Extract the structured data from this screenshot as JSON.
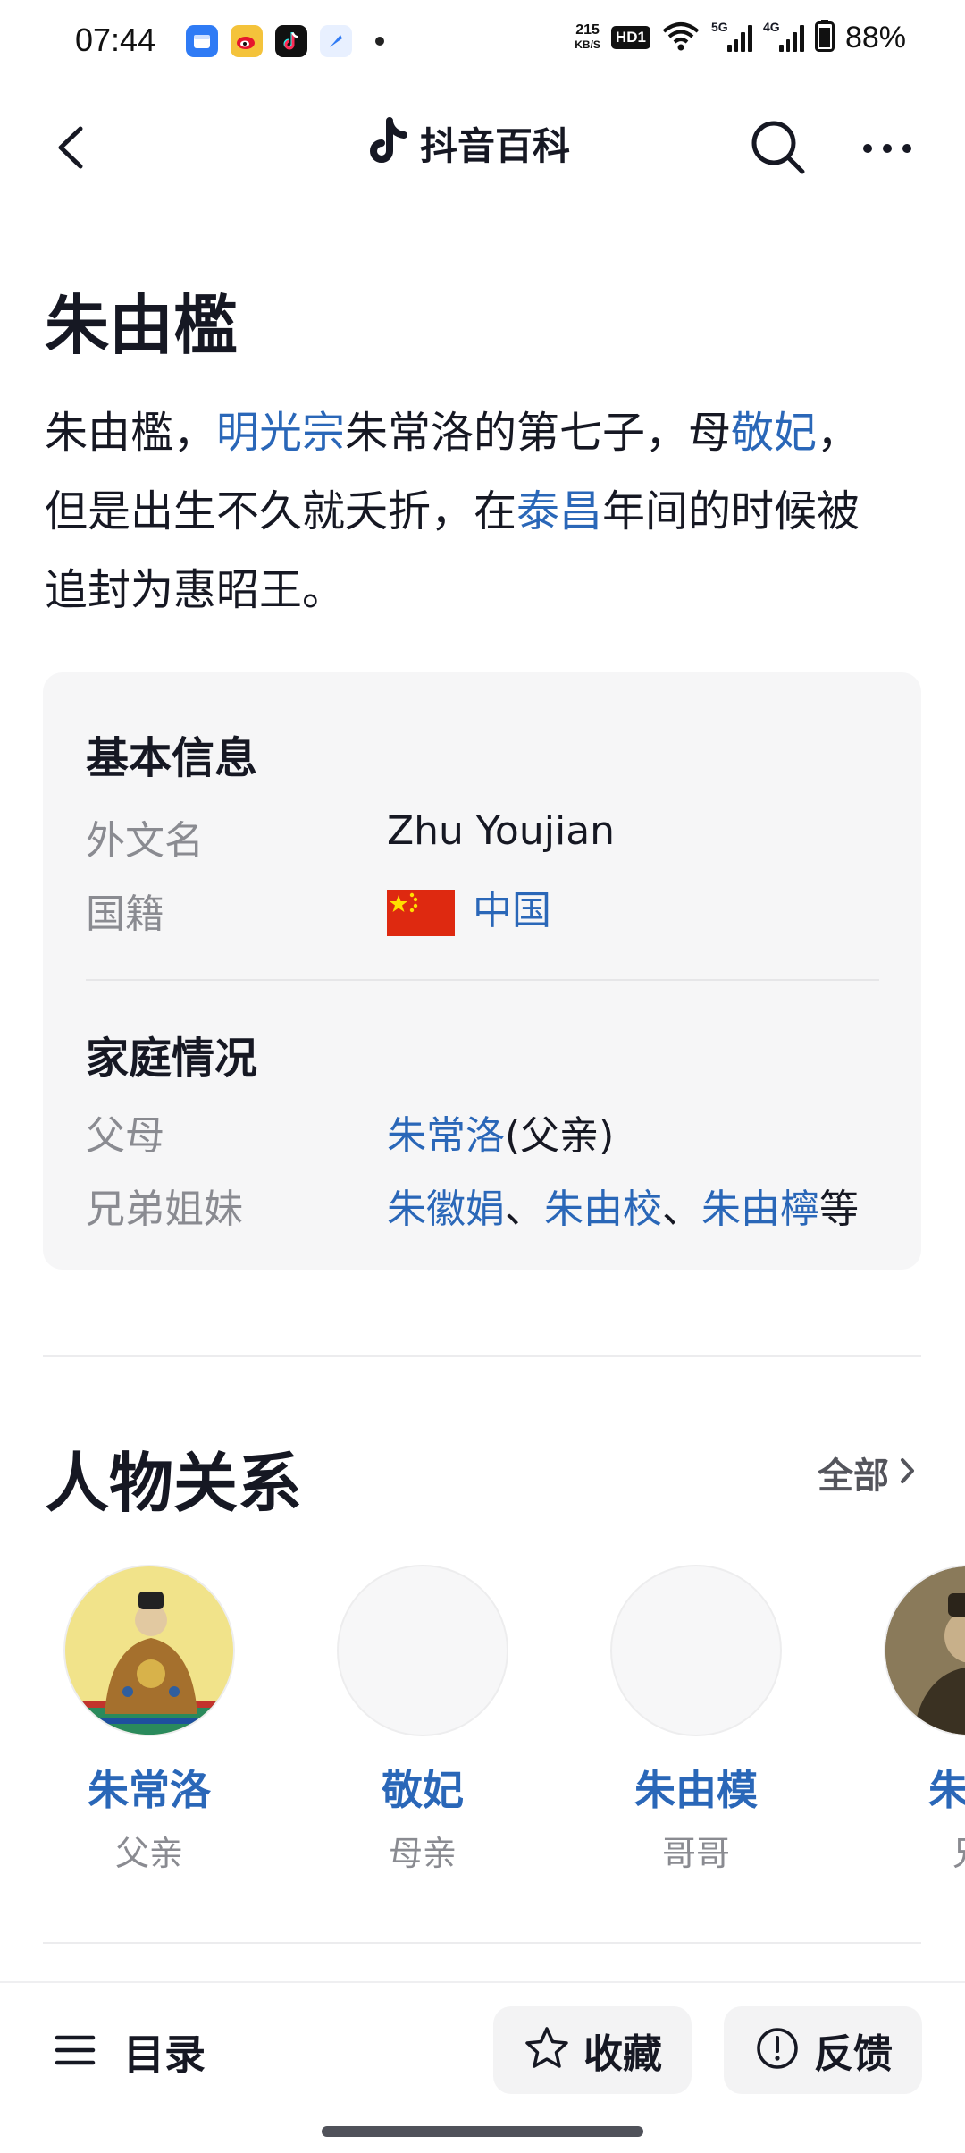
{
  "status": {
    "time": "07:44",
    "net_speed_value": "215",
    "net_speed_unit": "KB/S",
    "hd": "HD1",
    "sig1_tag": "5G",
    "sig2_tag": "4G",
    "battery": "88%"
  },
  "nav": {
    "brand": "抖音百科"
  },
  "article": {
    "title": "朱由檻",
    "summary": {
      "t1": "朱由檻，",
      "l1": "明光宗",
      "t2": "朱常洛的第七子，母",
      "l2": "敬妃",
      "t3": "，但是出生不久就夭折，在",
      "l3": "泰昌",
      "t4": "年间的时候被追封为惠昭王。"
    }
  },
  "infobox": {
    "basic_heading": "基本信息",
    "foreign_name_label": "外文名",
    "foreign_name_value": "Zhu Youjian",
    "nationality_label": "国籍",
    "nationality_value": "中国",
    "family_heading": "家庭情况",
    "parents_label": "父母",
    "parents_link": "朱常洛",
    "parents_note": "(父亲)",
    "siblings_label": "兄弟姐妹",
    "siblings": [
      "朱徽娟",
      "朱由校",
      "朱由檸"
    ],
    "sibling_sep": "、",
    "siblings_suffix": "等"
  },
  "relations": {
    "title": "人物关系",
    "more": "全部",
    "items": [
      {
        "name": "朱常洛",
        "role": "父亲"
      },
      {
        "name": "敬妃",
        "role": "母亲"
      },
      {
        "name": "朱由模",
        "role": "哥哥"
      },
      {
        "name": "朱由",
        "role": "兄"
      }
    ]
  },
  "bottom": {
    "toc": "目录",
    "favorite": "收藏",
    "feedback": "反馈"
  },
  "colors": {
    "link": "#2a67b8",
    "text": "#161823",
    "muted": "#8a8b91"
  }
}
